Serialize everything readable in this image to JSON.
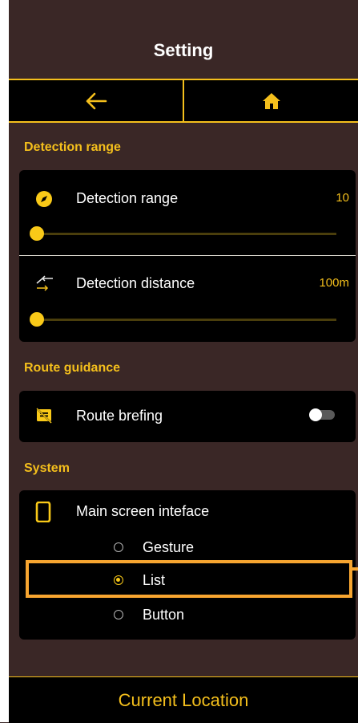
{
  "header": {
    "title": "Setting"
  },
  "nav": {
    "back_icon": "arrow-left-icon",
    "home_icon": "home-icon"
  },
  "sections": {
    "detection": {
      "title": "Detection range"
    },
    "route": {
      "title": "Route guidance"
    },
    "system": {
      "title": "System"
    }
  },
  "detection": {
    "range": {
      "label": "Detection range",
      "value": "10",
      "icon": "compass-icon",
      "slider_fraction": 0.0
    },
    "distance": {
      "label": "Detection distance",
      "value": "100m",
      "icon": "arrows-crossing-icon",
      "slider_fraction": 0.0
    }
  },
  "route": {
    "briefing": {
      "label": "Route brefing",
      "icon": "speaker-notes-off-icon",
      "enabled": false
    }
  },
  "system": {
    "main_screen": {
      "label": "Main screen inteface",
      "icon": "phone-icon",
      "options": [
        "Gesture",
        "List",
        "Button"
      ],
      "selected": "List"
    }
  },
  "footer": {
    "label": "Current Location"
  },
  "colors": {
    "accent": "#f4bf1c",
    "highlight": "#f7a530",
    "background": "#3a2726",
    "card": "#000000"
  }
}
